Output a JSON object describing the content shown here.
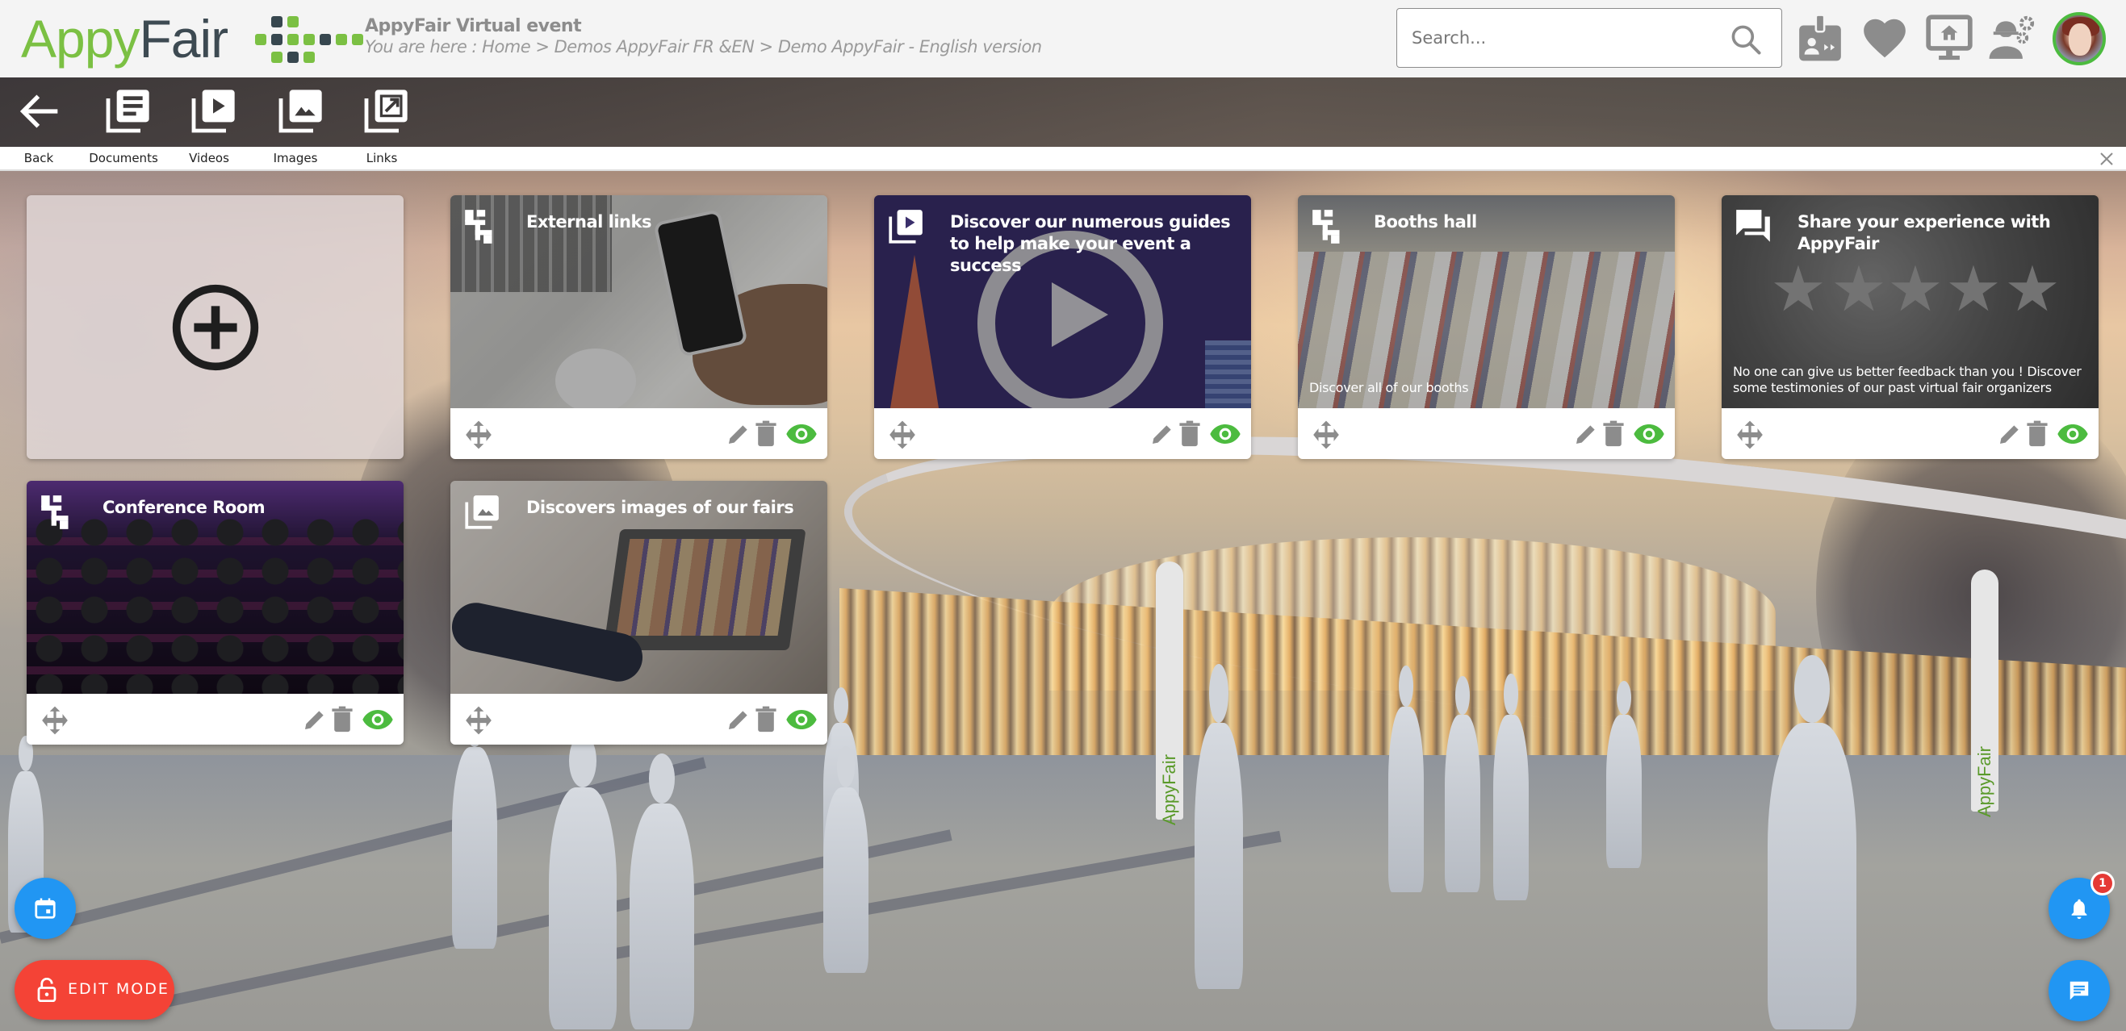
{
  "header": {
    "logo": {
      "part1": "Appy",
      "part2": "Fair"
    },
    "event_title": "AppyFair Virtual event",
    "breadcrumb": "You are here : Home > Demos AppyFair FR &EN > Demo AppyFair - English version",
    "search": {
      "placeholder": "Search...",
      "value": ""
    },
    "icons": [
      "badge-icon",
      "heart-icon",
      "monitor-home-icon",
      "worker-settings-icon"
    ],
    "avatar_label": "user-avatar"
  },
  "toolbar": {
    "buttons": [
      {
        "id": "back",
        "label": "Back",
        "icon": "arrow-left-icon"
      },
      {
        "id": "documents",
        "label": "Documents",
        "icon": "documents-icon"
      },
      {
        "id": "videos",
        "label": "Videos",
        "icon": "videos-icon"
      },
      {
        "id": "images",
        "label": "Images",
        "icon": "images-icon"
      },
      {
        "id": "links",
        "label": "Links",
        "icon": "links-icon"
      }
    ],
    "close_icon": "close-icon"
  },
  "tiles": [
    {
      "type": "add",
      "icon": "add-circle-icon"
    },
    {
      "type": "content",
      "title": "External links",
      "description": "",
      "icon": "sitemap-icon",
      "image": "links",
      "visible": true
    },
    {
      "type": "content",
      "title": "Discover our numerous guides to help make your event a success",
      "description": "",
      "icon": "video-library-icon",
      "image": "guides",
      "visible": true
    },
    {
      "type": "content",
      "title": "Booths hall",
      "description": "Discover all of our booths",
      "icon": "sitemap-icon",
      "image": "booths",
      "visible": true
    },
    {
      "type": "content",
      "title": "Share your experience with AppyFair",
      "description": "No one can give us better feedback than you ! Discover some testimonies of our past virtual fair organizers",
      "icon": "forum-icon",
      "image": "feedback",
      "visible": true
    },
    {
      "type": "content",
      "title": "Conference Room",
      "description": "",
      "icon": "sitemap-icon",
      "image": "conf",
      "visible": true
    },
    {
      "type": "content",
      "title": "Discovers images of our fairs",
      "description": "",
      "icon": "photo-library-icon",
      "image": "images",
      "visible": true
    }
  ],
  "floating": {
    "calendar_icon": "calendar-icon",
    "edit_mode_label": "EDIT MODE",
    "notifications_count": "1",
    "chat_icon": "chat-icon"
  },
  "scene": {
    "flag_text": "AppyFair"
  },
  "colors": {
    "brand_green": "#7bc043",
    "brand_dark": "#37474f",
    "fab_blue": "#2196f3",
    "edit_red": "#f44336",
    "visible_green": "#4cbb3f",
    "icon_grey": "#8c8c8c"
  }
}
